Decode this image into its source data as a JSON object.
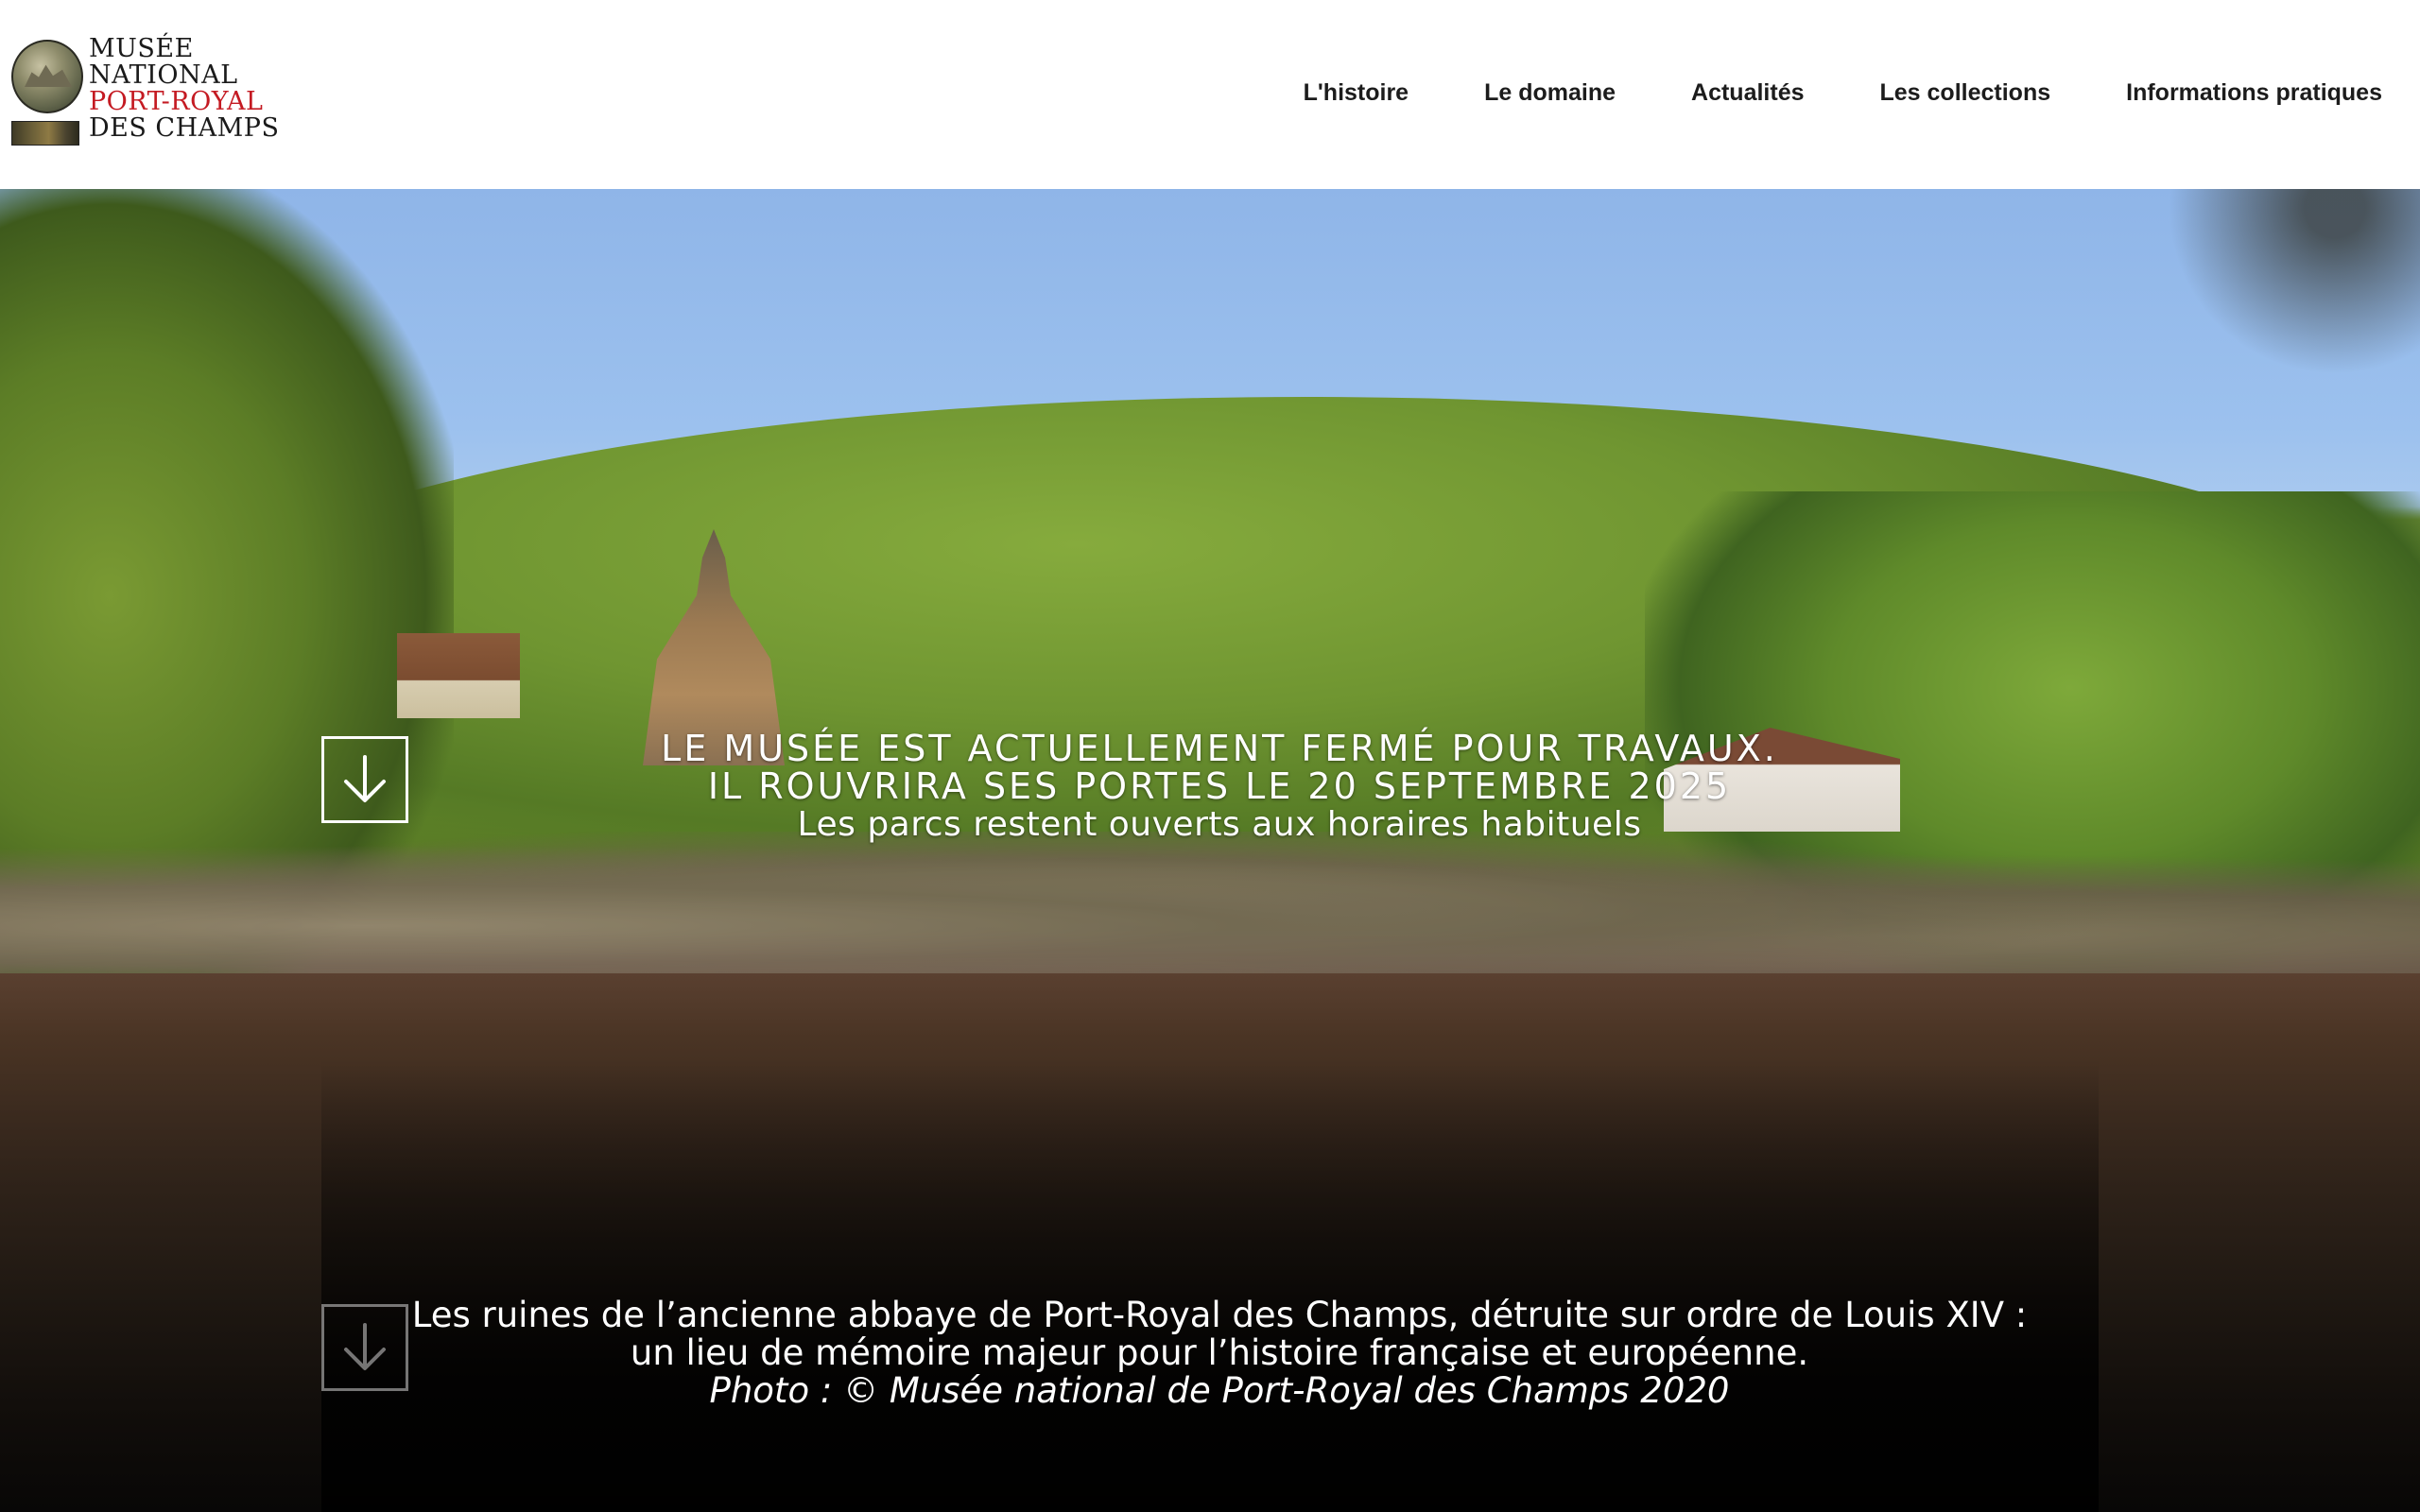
{
  "logo": {
    "line1": "Musée",
    "line2": "National",
    "line3": "Port-Royal",
    "line4": "des Champs"
  },
  "nav": {
    "items": [
      {
        "label": "L'histoire"
      },
      {
        "label": "Le domaine"
      },
      {
        "label": "Actualités"
      },
      {
        "label": "Les collections"
      },
      {
        "label": "Informations pratiques"
      }
    ]
  },
  "hero": {
    "notice": {
      "line1": "Le musée est actuellement fermé pour travaux.",
      "line2": "Il rouvrira ses portes le 20 septembre 2025",
      "line3": "Les parcs restent ouverts aux horaires habituels"
    },
    "caption": {
      "line1": "Les ruines de l’ancienne abbaye de Port-Royal des Champs, détruite sur ordre de Louis XIV :",
      "line2": "un lieu de mémoire majeur pour l’histoire française et européenne.",
      "credit": "Photo : © Musée national de Port-Royal des Champs 2020"
    }
  },
  "colors": {
    "accent_red": "#c41a22",
    "nav_text": "#1c1c1c",
    "overlay_text": "#ffffff"
  },
  "icons": {
    "scroll_down": "arrow-down-icon",
    "logo_medallion": "abbey-medallion-icon"
  }
}
